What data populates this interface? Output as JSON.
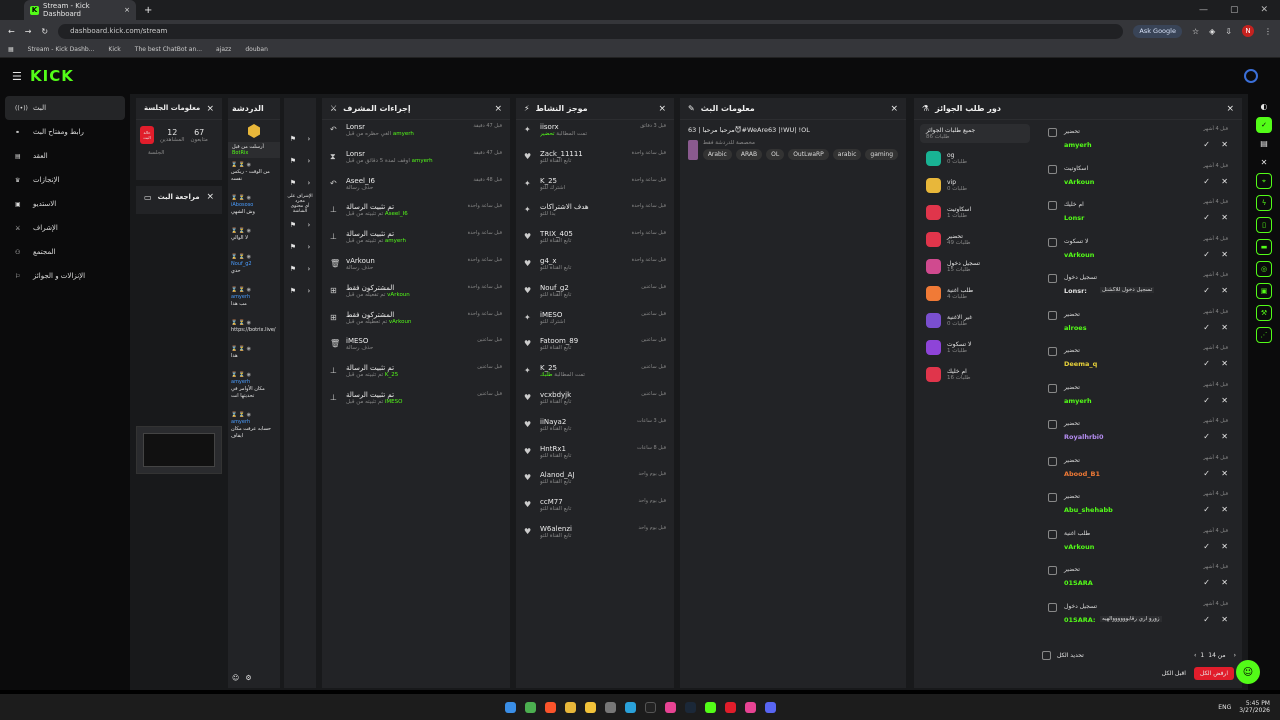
{
  "browser": {
    "tab_title": "Stream - Kick Dashboard",
    "url": "dashboard.kick.com/stream",
    "ask_google": "Ask Google",
    "profile": "N",
    "bookmarks": [
      "Stream - Kick Dashb...",
      "Kick",
      "The best ChatBot an...",
      "ajazz",
      "douban"
    ]
  },
  "app": {
    "logo": "KICK"
  },
  "sidebar": {
    "items": [
      "البث",
      "رابط ومفتاح البث",
      "العقد",
      "الإنجازات",
      "الاستديو",
      "الإشراف",
      "المجتمع",
      "الإنزالات و الجوائز"
    ],
    "icons": [
      "live-icon",
      "link-icon",
      "contract-icon",
      "trophy-icon",
      "studio-icon",
      "moderation-icon",
      "community-icon",
      "drops-icon"
    ]
  },
  "session": {
    "title": "معلومات الجلسة",
    "live_badge": "حالة البث",
    "viewers_value": "12",
    "viewers_label": "المشاهدين",
    "followers_value": "67",
    "followers_label": "متابعون",
    "watch_label": "الجلسة"
  },
  "review": {
    "title": "مراجعة البث"
  },
  "chat": {
    "title": "الدردشة",
    "pinned": "أرسلت من قبل",
    "bot_name": "BotRix",
    "messages": [
      {
        "user": "",
        "text": "من الوقت - ريكس نفسه"
      },
      {
        "user": "iAbososo",
        "text": "وش الشهي"
      },
      {
        "user": "",
        "text": "لا الوالي"
      },
      {
        "user": "Nouf_g2",
        "text": "حدي"
      },
      {
        "user": "amyerh",
        "text": "مب هذا"
      },
      {
        "user": "",
        "text": "https://botrix.live/"
      },
      {
        "user": "",
        "text": "هذا"
      },
      {
        "user": "amyerh",
        "text": "مكان الأوامر في تحديثها انت"
      },
      {
        "user": "amyerh",
        "text": "حسابه عرفت مكان ايقاف"
      }
    ]
  },
  "mod_tools": {
    "title": "",
    "items": [
      "الإشراف على",
      "مجرد",
      "أي محتوى",
      "الشاشة"
    ]
  },
  "mod_actions": {
    "title": "إجراءات المشرف",
    "rows": [
      {
        "icon": "undo-icon",
        "title": "Lonsr",
        "sub": "ألغي حظره من قبل",
        "by": "amyerh",
        "time": "قبل 47 دقيقة"
      },
      {
        "icon": "timeout-icon",
        "title": "Lonsr",
        "sub": "أوقف لمدة 5 دقائق من قبل",
        "by": "amyerh",
        "time": "قبل 47 دقيقة"
      },
      {
        "icon": "undo-icon",
        "title": "Aseel_I6",
        "sub": "حذف رسالة",
        "by": "",
        "time": "قبل 48 دقيقة"
      },
      {
        "icon": "pin-icon",
        "title": "تم تثبيت الرسالة",
        "sub": "تم تثبيته من قبل",
        "by": "Aseel_I6",
        "time": "قبل ساعة واحدة"
      },
      {
        "icon": "pin-icon",
        "title": "تم تثبيت الرسالة",
        "sub": "تم تثبيته من قبل",
        "by": "amyerh",
        "time": "قبل ساعة واحدة"
      },
      {
        "icon": "trash-icon",
        "title": "vArkoun",
        "sub": "حذف رسالة",
        "by": "",
        "time": "قبل ساعة واحدة"
      },
      {
        "icon": "gift-icon",
        "title": "المشتركون فقط",
        "sub": "تم تفعيله من قبل",
        "by": "vArkoun",
        "time": "قبل ساعة واحدة"
      },
      {
        "icon": "gift-icon",
        "title": "المشتركون فقط",
        "sub": "تم تعطيله من قبل",
        "by": "vArkoun",
        "time": "قبل ساعة واحدة"
      },
      {
        "icon": "trash-icon",
        "title": "iMESO",
        "sub": "حذف رسالة",
        "by": "",
        "time": "قبل ساعتين"
      },
      {
        "icon": "pin-icon",
        "title": "تم تثبيت الرسالة",
        "sub": "تم تثبيته من قبل",
        "by": "K_25",
        "time": "قبل ساعتين"
      },
      {
        "icon": "pin-icon",
        "title": "تم تثبيت الرسالة",
        "sub": "تم تثبيته من قبل",
        "by": "iMESO",
        "time": "قبل ساعتين"
      }
    ]
  },
  "activity": {
    "title": "موجز النشاط",
    "rows": [
      {
        "icon": "star-icon",
        "title": "iisorx",
        "sub": "تمت المطالبة",
        "by": "تحضير",
        "time": "قبل 3 دقائق"
      },
      {
        "icon": "heart-icon",
        "title": "Zack_11111",
        "sub": "تابع القناة للتو",
        "time": "قبل ساعة واحدة"
      },
      {
        "icon": "star-icon",
        "title": "K_25",
        "sub": "اشترك للتو",
        "time": "قبل ساعة واحدة"
      },
      {
        "icon": "star-icon",
        "title": "هدف الاشتراكات",
        "sub": "بدأ للتو",
        "time": "قبل ساعة واحدة"
      },
      {
        "icon": "heart-icon",
        "title": "TRIX_405",
        "sub": "تابع القناة للتو",
        "time": "قبل ساعة واحدة"
      },
      {
        "icon": "heart-icon",
        "title": "g4_x",
        "sub": "تابع القناة للتو",
        "time": "قبل ساعة واحدة"
      },
      {
        "icon": "heart-icon",
        "title": "Nouf_g2",
        "sub": "تابع القناة للتو",
        "time": "قبل ساعتين"
      },
      {
        "icon": "star-icon",
        "title": "iMESO",
        "sub": "اشترك للتو",
        "time": "قبل ساعتين"
      },
      {
        "icon": "heart-icon",
        "title": "Fatoom_89",
        "sub": "تابع القناة للتو",
        "time": "قبل ساعتين"
      },
      {
        "icon": "star-icon",
        "title": "K_25",
        "sub": "تمت المطالبة",
        "by": "طلبك",
        "time": "قبل ساعتين"
      },
      {
        "icon": "heart-icon",
        "title": "vcxbdyjk",
        "sub": "تابع القناة للتو",
        "time": "قبل ساعتين"
      },
      {
        "icon": "heart-icon",
        "title": "iiNaya2",
        "sub": "تابع القناة للتو",
        "time": "قبل 3 ساعات"
      },
      {
        "icon": "heart-icon",
        "title": "HntRx1",
        "sub": "تابع القناة للتو",
        "time": "قبل 8 ساعات"
      },
      {
        "icon": "heart-icon",
        "title": "Alanod_AJ",
        "sub": "تابع القناة للتو",
        "time": "قبل يوم واحد"
      },
      {
        "icon": "heart-icon",
        "title": "ccM77",
        "sub": "تابع القناة للتو",
        "time": "قبل يوم واحد"
      },
      {
        "icon": "heart-icon",
        "title": "W6alenzi",
        "sub": "تابع القناة للتو",
        "time": "قبل يوم واحد"
      }
    ]
  },
  "stream_info": {
    "title": "معلومات البث",
    "stream_title": "مرحبا مرحبا | 63😈#WeAre63 |!WU| !OL",
    "category": "مخصصة للدردشة فقط",
    "tags": [
      "Arabic",
      "ARAB",
      "OL",
      "OutLwaRP",
      "arabic",
      "gaming"
    ]
  },
  "rewards": {
    "title": "دور طلب الجوائز",
    "all_label": "جميع طلبات الجوائز",
    "all_count": "طلبات 86",
    "categories": [
      {
        "name": "og",
        "count": "طلبات 0",
        "color": "#19b394"
      },
      {
        "name": "vip",
        "count": "طلبات 0",
        "color": "#e8b73a"
      },
      {
        "name": "اسكاوتيت",
        "count": "طلبات 1",
        "color": "#e0354b"
      },
      {
        "name": "تحضير",
        "count": "طلبات 49",
        "color": "#e0354b"
      },
      {
        "name": "تسجيل دخول",
        "count": "طلبات 15",
        "color": "#d04a8f"
      },
      {
        "name": "طلب اغنية",
        "count": "طلبات 4",
        "color": "#f07a36"
      },
      {
        "name": "غير الاغنية",
        "count": "طلبات 0",
        "color": "#7a4fcf"
      },
      {
        "name": "لا تسكوت",
        "count": "طلبات 1",
        "color": "#8e44d8"
      },
      {
        "name": "ام خليك",
        "count": "طلبات 16",
        "color": "#e0354b"
      }
    ],
    "queue": [
      {
        "reward": "تحضير",
        "user": "amyerh",
        "ucolor": "#53fc18",
        "time": "قبل 4 أشهر",
        "note": ""
      },
      {
        "reward": "اسكاوتيت",
        "user": "vArkoun",
        "ucolor": "#53fc18",
        "time": "قبل 4 أشهر",
        "note": ""
      },
      {
        "reward": "ام خليك",
        "user": "Lonsr",
        "ucolor": "#53fc18",
        "time": "قبل 4 أشهر",
        "note": ""
      },
      {
        "reward": "لا تسكوت",
        "user": "vArkoun",
        "ucolor": "#53fc18",
        "time": "قبل 4 أشهر",
        "note": ""
      },
      {
        "reward": "تسجيل دخول",
        "user": "Lonsr:",
        "ucolor": "#e6e6e6",
        "time": "قبل 4 أشهر",
        "note": "تسجيل دخول للأكشنل"
      },
      {
        "reward": "تحضير",
        "user": "alroes",
        "ucolor": "#53fc18",
        "time": "قبل 4 أشهر",
        "note": ""
      },
      {
        "reward": "تحضير",
        "user": "Deema_q",
        "ucolor": "#e8d23a",
        "time": "قبل 4 أشهر",
        "note": ""
      },
      {
        "reward": "تحضير",
        "user": "amyerh",
        "ucolor": "#53fc18",
        "time": "قبل 4 أشهر",
        "note": ""
      },
      {
        "reward": "تحضير",
        "user": "Royalhrbi0",
        "ucolor": "#b48cf0",
        "time": "قبل 4 أشهر",
        "note": ""
      },
      {
        "reward": "تحضير",
        "user": "Abood_B1",
        "ucolor": "#f07a36",
        "time": "قبل 4 أشهر",
        "note": ""
      },
      {
        "reward": "تحضير",
        "user": "Abu_shehabb",
        "ucolor": "#53fc18",
        "time": "قبل 4 أشهر",
        "note": ""
      },
      {
        "reward": "طلب اغنية",
        "user": "vArkoun",
        "ucolor": "#53fc18",
        "time": "قبل 4 أشهر",
        "note": ""
      },
      {
        "reward": "تحضير",
        "user": "01SARA",
        "ucolor": "#53fc18",
        "time": "قبل 4 أشهر",
        "note": ""
      },
      {
        "reward": "تسجيل دخول",
        "user": "01SARA:",
        "ucolor": "#53fc18",
        "time": "قبل 4 أشهر",
        "note": "زورو اري رقابووووووالهيه"
      }
    ],
    "select_all": "تحديد الكل",
    "pagination": "من 14",
    "page": "1",
    "reject_all": "ارفض الكل",
    "accept_all": "اقبل الكل"
  },
  "taskbar": {
    "lang": "ENG",
    "time": "5:45 PM",
    "date": "3/27/2026"
  }
}
